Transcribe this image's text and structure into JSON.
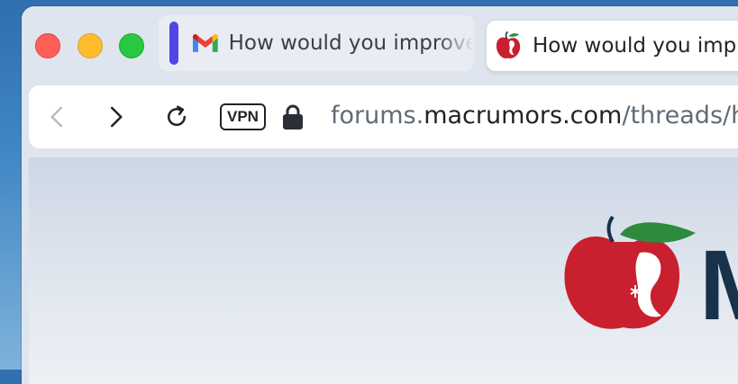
{
  "tabs": [
    {
      "title": "How would you improve",
      "favicon": "gmail-icon",
      "active": false
    },
    {
      "title": "How would you improve",
      "favicon": "macrumors-apple-icon",
      "active": true
    }
  ],
  "toolbar": {
    "vpn_label": "VPN",
    "url_prefix": "forums.",
    "url_domain": "macrumors.com",
    "url_path": "/threads/ho"
  },
  "content": {
    "logo_letter": "M"
  },
  "colors": {
    "tab_accent": "#4f46e5",
    "logo_red": "#c8202f",
    "logo_green": "#2e8b3e",
    "logo_navy": "#17324a"
  }
}
